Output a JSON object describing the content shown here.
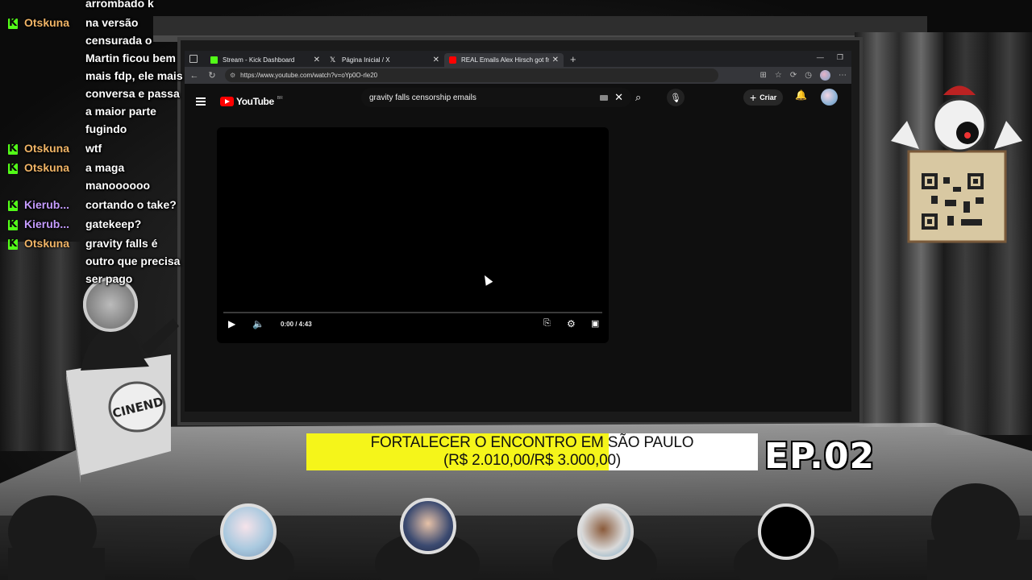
{
  "chat": [
    {
      "user": "",
      "text": "arrombado k",
      "color": "#f0c078",
      "cont": true
    },
    {
      "user": "Otskuna",
      "text": "na versão censurada o Martin ficou bem mais fdp, ele mais conversa e passa a maior parte fugindo",
      "color": "#f0b466",
      "cont": false
    },
    {
      "user": "Otskuna",
      "text": "wtf",
      "color": "#f0b466",
      "cont": false
    },
    {
      "user": "Otskuna",
      "text": "a maga manoooooo",
      "color": "#f0b466",
      "cont": false
    },
    {
      "user": "Kierub...",
      "text": "cortando o take?",
      "color": "#c59cff",
      "cont": false
    },
    {
      "user": "Kierub...",
      "text": "gatekeep?",
      "color": "#c59cff",
      "cont": false
    },
    {
      "user": "Otskuna",
      "text": "gravity falls é outro que precisa ser pago",
      "color": "#f0b466",
      "cont": false
    }
  ],
  "browser": {
    "tabs": [
      {
        "label": "Stream - Kick Dashboard",
        "icon": "kick-icon",
        "active": false
      },
      {
        "label": "Página Inicial / X",
        "icon": "x-icon",
        "active": false
      },
      {
        "label": "REAL Emails Alex Hirsch got from",
        "icon": "youtube-icon",
        "active": true
      }
    ],
    "url": "https://www.youtube.com/watch?v=oYp0O-rle20"
  },
  "youtube": {
    "logo_text": "YouTube",
    "region": "BR",
    "search_query": "gravity falls censorship emails",
    "create_label": "Criar",
    "time_display": "0:00 / 4:43",
    "progress": 0
  },
  "overlay": {
    "goal_line1": "FORTALECER O ENCONTRO EM SÃO PAULO",
    "goal_line2": "(R$ 2.010,00/R$ 3.000,00)",
    "goal_progress": 0.67,
    "episode": "EP.02",
    "podium_text": "CINEND"
  },
  "colors": {
    "kick_green": "#53fc18",
    "youtube_red": "#ff0000",
    "banner_yellow": "#f5f51a"
  }
}
